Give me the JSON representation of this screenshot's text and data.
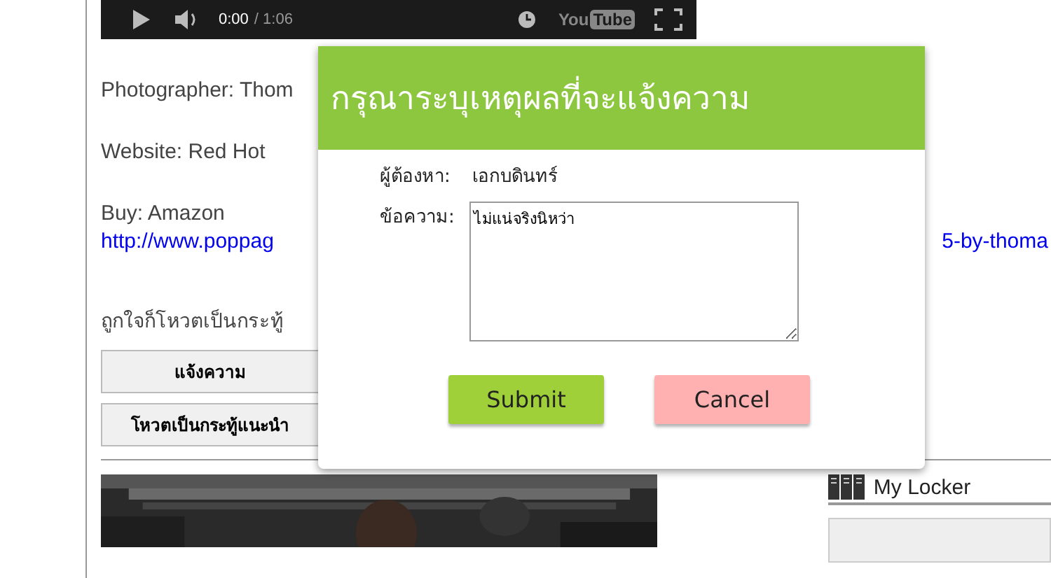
{
  "video_player": {
    "current_time": "0:00",
    "duration": "/ 1:06",
    "logo": [
      "You",
      "Tube"
    ]
  },
  "article": {
    "photographer": "Photographer: Thom",
    "website": "Website: Red Hot",
    "buy": "Buy: Amazon",
    "link_start": "http://www.poppag",
    "link_end": "5-by-thoma",
    "vote_prompt": "ถูกใจก็โหวตเป็นกระทู้",
    "buttons": [
      "แจ้งความ",
      "โหวตเป็นกระทู้แนะนำ"
    ]
  },
  "sidebar": {
    "title": "My Locker"
  },
  "dialog": {
    "title": "กรุณาระบุเหตุผลที่จะแจ้งความ",
    "suspect_label": "ผู้ต้องหา:",
    "suspect_value": "เอกบดินทร์",
    "message_label": "ข้อความ:",
    "message_value": "ไม่แน่จริงนิหว่า",
    "buttons": [
      {
        "label": "Submit",
        "kind": "primary"
      },
      {
        "label": "Cancel",
        "kind": "cancel"
      }
    ]
  }
}
